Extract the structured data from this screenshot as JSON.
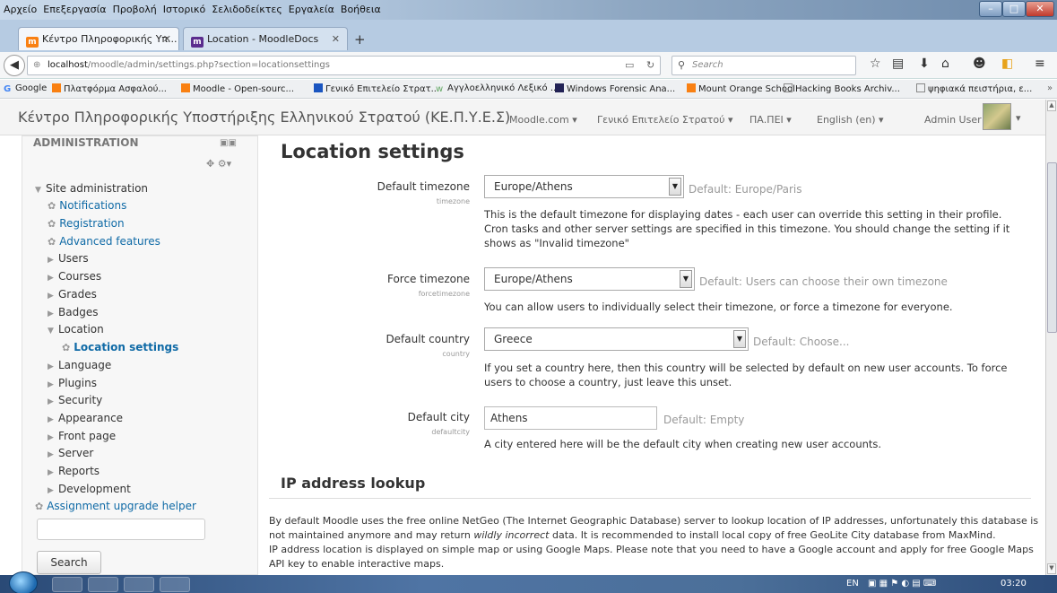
{
  "browser": {
    "menus": [
      "Αρχείο",
      "Επεξεργασία",
      "Προβολή",
      "Ιστορικό",
      "Σελιδοδείκτες",
      "Εργαλεία",
      "Βοήθεια"
    ],
    "tabs": [
      {
        "label": "Κέντρο Πληροφορικής Υπ...",
        "active": true
      },
      {
        "label": "Location - MoodleDocs",
        "active": false
      }
    ],
    "url_host": "localhost",
    "url_path": "/moodle/admin/settings.php?section=locationsettings",
    "search_placeholder": "Search",
    "bookmarks": [
      "Google",
      "Πλατφόρμα Ασφαλού...",
      "Moodle - Open-sourc...",
      "Γενικό Επιτελείο Στρατ...",
      "Αγγλοελληνικό Λεξικό ...",
      "Windows Forensic Ana...",
      "Mount Orange School",
      "Hacking Books Archiv...",
      "ψηφιακά πειστήρια, ε..."
    ]
  },
  "header": {
    "site_name": "Κέντρο Πληροφορικής Υποστήριξης Ελληνικού Στρατού (ΚΕ.Π.Υ.Ε.Σ)",
    "nav": [
      "Moodle.com ▾",
      "Γενικό Επιτελείο Στρατού ▾",
      "ΠΑ.ΠΕΙ ▾",
      "English (en) ▾"
    ],
    "user": "Admin User"
  },
  "sidebar": {
    "title": "ADMINISTRATION",
    "items": [
      {
        "label": "Site administration",
        "type": "expanded"
      },
      {
        "label": "Notifications",
        "type": "link"
      },
      {
        "label": "Registration",
        "type": "link"
      },
      {
        "label": "Advanced features",
        "type": "link"
      },
      {
        "label": "Users",
        "type": "collapsed"
      },
      {
        "label": "Courses",
        "type": "collapsed"
      },
      {
        "label": "Grades",
        "type": "collapsed"
      },
      {
        "label": "Badges",
        "type": "collapsed"
      },
      {
        "label": "Location",
        "type": "expanded"
      },
      {
        "label": "Location settings",
        "type": "current"
      },
      {
        "label": "Language",
        "type": "collapsed"
      },
      {
        "label": "Plugins",
        "type": "collapsed"
      },
      {
        "label": "Security",
        "type": "collapsed"
      },
      {
        "label": "Appearance",
        "type": "collapsed"
      },
      {
        "label": "Front page",
        "type": "collapsed"
      },
      {
        "label": "Server",
        "type": "collapsed"
      },
      {
        "label": "Reports",
        "type": "collapsed"
      },
      {
        "label": "Development",
        "type": "collapsed"
      },
      {
        "label": "Assignment upgrade helper",
        "type": "link"
      }
    ],
    "search_button": "Search"
  },
  "main": {
    "title": "Location settings",
    "settings": [
      {
        "label": "Default timezone",
        "key": "timezone",
        "value": "Europe/Athens",
        "default": "Default: Europe/Paris",
        "desc": "This is the default timezone for displaying dates - each user can override this setting in their profile. Cron tasks and other server settings are specified in this timezone. You should change the setting if it shows as \"Invalid timezone\""
      },
      {
        "label": "Force timezone",
        "key": "forcetimezone",
        "value": "Europe/Athens",
        "default": "Default: Users can choose their own timezone",
        "desc": "You can allow users to individually select their timezone, or force a timezone for everyone."
      },
      {
        "label": "Default country",
        "key": "country",
        "value": "Greece",
        "default": "Default: Choose...",
        "desc": "If you set a country here, then this country will be selected by default on new user accounts. To force users to choose a country, just leave this unset."
      },
      {
        "label": "Default city",
        "key": "defaultcity",
        "value": "Athens",
        "default": "Default: Empty",
        "desc": "A city entered here will be the default city when creating new user accounts."
      }
    ],
    "ip_heading": "IP address lookup",
    "ip_desc_1": "By default Moodle uses the free online NetGeo (The Internet Geographic Database) server to lookup location of IP addresses, unfortunately this database is not maintained anymore and may return ",
    "ip_desc_em": "wildly incorrect",
    "ip_desc_2": " data. It is recommended to install local copy of free GeoLite City database from MaxMind.",
    "ip_desc_3": "IP address location is displayed on simple map or using Google Maps. Please note that you need to have a Google account and apply for free Google Maps API key to enable interactive maps."
  },
  "taskbar": {
    "lang": "EN",
    "time": "03:20"
  }
}
